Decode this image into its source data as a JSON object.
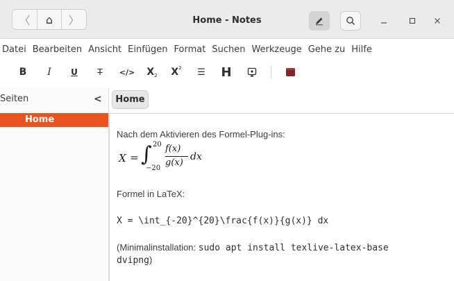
{
  "window": {
    "title": "Home - Notes",
    "nav": {
      "back": "〈",
      "home": "⌂",
      "forward": "〉"
    }
  },
  "menu": [
    "Datei",
    "Bearbeiten",
    "Ansicht",
    "Einfügen",
    "Format",
    "Suchen",
    "Werkzeuge",
    "Gehe zu",
    "Hilfe"
  ],
  "toolbar": {
    "bold": "B",
    "italic": "I",
    "underline": "U",
    "strike": "T",
    "code": "</>",
    "subscript": "X",
    "superscript": "X",
    "list": "☰",
    "heading": "H",
    "insert_icon": "image-icon",
    "notebook_icon": "notebook-icon"
  },
  "sidebar": {
    "title": "Seiten",
    "collapse": "<",
    "pages": [
      {
        "label": "Home",
        "selected": true
      }
    ]
  },
  "pathbar": {
    "label": "Home"
  },
  "document": {
    "line1": "Nach dem Aktivieren des Formel-Plug-ins:",
    "formula": {
      "lhs": "X",
      "eq": "=",
      "integral": "∫",
      "upper": "20",
      "lower": "−20",
      "numerator": "f(x)",
      "denominator": "g(x)",
      "differential": "dx"
    },
    "line2": "Formel in LaTeX:",
    "latex": "X = \\int_{-20}^{20}\\frac{f(x)}{g(x)} dx",
    "note_prefix": "(Minimalinstallation: ",
    "note_cmd": "sudo apt install texlive-latex-base",
    "note_cmd2": "dvipng",
    "note_suffix": ")"
  },
  "colors": {
    "accent": "#e95420"
  }
}
